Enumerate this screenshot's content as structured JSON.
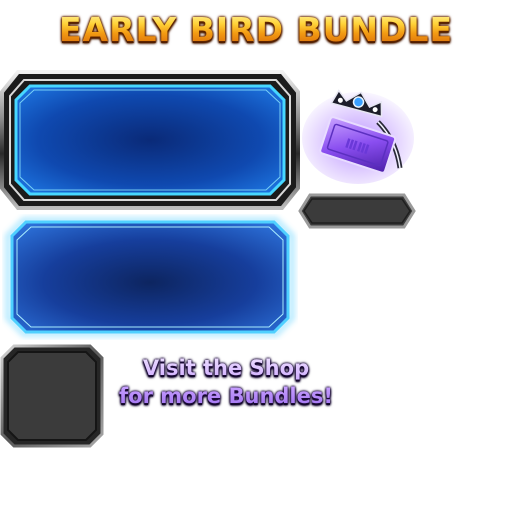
{
  "title": "EARLY BIRD BUNDLE",
  "promo": {
    "line1": "Visit the Shop",
    "line2": "for more Bundles!"
  },
  "colors": {
    "title_gold": "#f2a21a",
    "frame_blue": "#1a5fd6",
    "glow_cyan": "#47d7ff",
    "promo_purple": "#c9a2ff",
    "dark_slot": "#3a3a3a",
    "item_violet": "#8a4ef0"
  },
  "icons": {
    "item": "ticket-crown-icon"
  }
}
